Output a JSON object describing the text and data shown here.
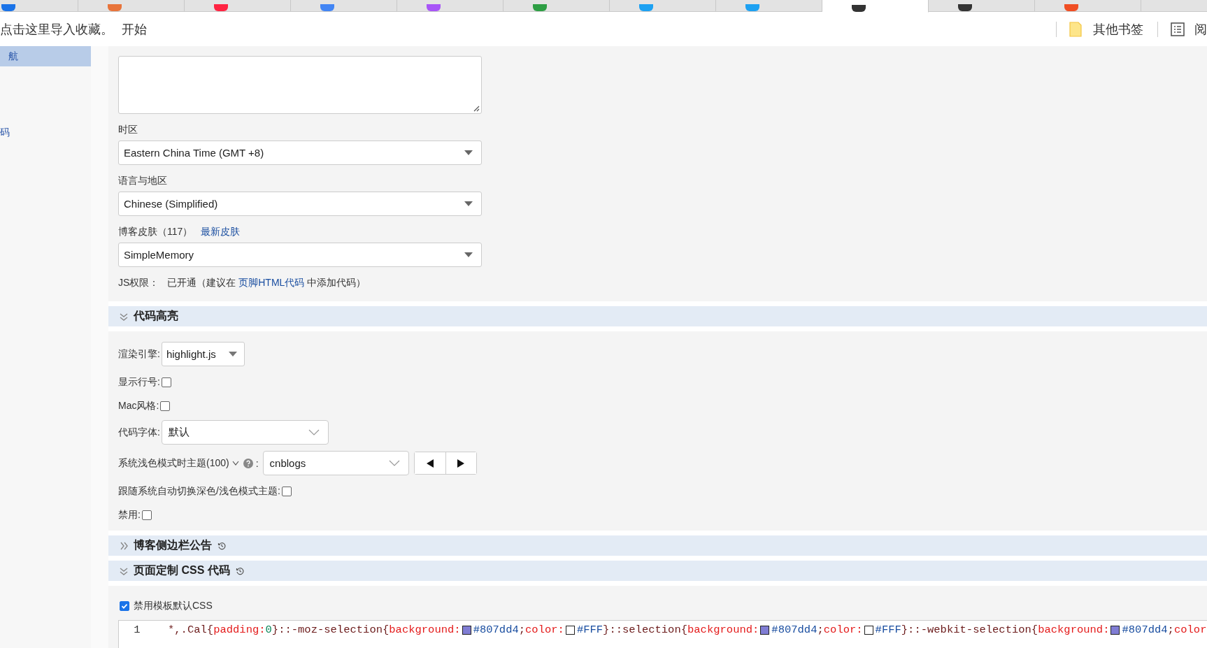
{
  "browser": {
    "tabs": [
      {
        "selected": false,
        "color": "#1a73e8"
      },
      {
        "selected": false,
        "color": "#e8743b"
      },
      {
        "selected": false,
        "color": "#ff2442"
      },
      {
        "selected": false,
        "color": "#4285f4"
      },
      {
        "selected": false,
        "color": "#a855f7"
      },
      {
        "selected": false,
        "color": "#2e9e44"
      },
      {
        "selected": false,
        "color": "#1da1f2"
      },
      {
        "selected": false,
        "color": "#1da1f2"
      },
      {
        "selected": true,
        "color": "#333333"
      },
      {
        "selected": false,
        "color": "#333333"
      },
      {
        "selected": false,
        "color": "#f04e23"
      }
    ],
    "bookmarks_bar": {
      "import_text": "点击这里导入收藏。",
      "start": "开始",
      "other_bookmarks": "其他书签",
      "reading_list": "阅"
    }
  },
  "sidebar": {
    "items": [
      {
        "label": "航",
        "selected": true
      },
      {
        "label": "码",
        "selected": false
      }
    ]
  },
  "basic_settings": {
    "fields": [
      {
        "label": "时区",
        "value": "Eastern China Time (GMT +8)"
      },
      {
        "label": "语言与地区",
        "value": "Chinese (Simplified)"
      },
      {
        "label": "博客皮肤（117）",
        "link": "最新皮肤",
        "value": "SimpleMemory"
      }
    ],
    "js_permission": {
      "label": "JS权限：",
      "before": "已开通（建议在 ",
      "link": "页脚HTML代码",
      "after": " 中添加代码）"
    }
  },
  "sections": [
    {
      "title": "代码高亮",
      "expanded": true,
      "rows": [
        {
          "kind": "dropdown",
          "label": "渲染引擎:",
          "value": "highlight.js"
        },
        {
          "kind": "checkbox",
          "label": "显示行号:",
          "checked": false
        },
        {
          "kind": "checkbox",
          "label": "Mac风格:",
          "checked": false
        },
        {
          "kind": "select",
          "label": "代码字体:",
          "value": "默认"
        },
        {
          "kind": "theme",
          "label": "系统浅色模式时主题(100)",
          "separator": ":",
          "value": "cnblogs"
        },
        {
          "kind": "checkbox",
          "label": "跟随系统自动切换深色/浅色模式主题:",
          "checked": false
        },
        {
          "kind": "checkbox",
          "label": "禁用:",
          "checked": false
        }
      ]
    },
    {
      "title": "博客侧边栏公告",
      "expanded": false,
      "history": true
    },
    {
      "title": "页面定制 CSS 代码",
      "expanded": true,
      "history": true,
      "rows": [
        {
          "kind": "check_label",
          "label": "禁用模板默认CSS",
          "checked": true
        },
        {
          "kind": "code",
          "lines": [
            {
              "number": "1",
              "tokens": [
                {
                  "kind": "sel",
                  "text": "*,.Cal{"
                },
                {
                  "kind": "prop",
                  "text": "padding:"
                },
                {
                  "kind": "num",
                  "text": "0"
                },
                {
                  "kind": "sel",
                  "text": "}::-moz-selection{"
                },
                {
                  "kind": "prop",
                  "text": "background:"
                },
                {
                  "kind": "swatch",
                  "color": "#807dd4"
                },
                {
                  "kind": "hex",
                  "text": "#807dd4"
                },
                {
                  "kind": "sel",
                  "text": ";"
                },
                {
                  "kind": "prop",
                  "text": "color:"
                },
                {
                  "kind": "swatch",
                  "color": "#ffffff"
                },
                {
                  "kind": "hex",
                  "text": "#FFF"
                },
                {
                  "kind": "sel",
                  "text": "}::selection{"
                },
                {
                  "kind": "prop",
                  "text": "background:"
                },
                {
                  "kind": "swatch",
                  "color": "#807dd4"
                },
                {
                  "kind": "hex",
                  "text": "#807dd4"
                },
                {
                  "kind": "sel",
                  "text": ";"
                },
                {
                  "kind": "prop",
                  "text": "color:"
                },
                {
                  "kind": "swatch",
                  "color": "#ffffff"
                },
                {
                  "kind": "hex",
                  "text": "#FFF"
                },
                {
                  "kind": "sel",
                  "text": "}::-webkit-selection{"
                },
                {
                  "kind": "prop",
                  "text": "background:"
                },
                {
                  "kind": "swatch",
                  "color": "#807dd4"
                },
                {
                  "kind": "hex",
                  "text": "#807dd4"
                },
                {
                  "kind": "sel",
                  "text": ";"
                },
                {
                  "kind": "prop",
                  "text": "color"
                }
              ]
            }
          ]
        }
      ]
    }
  ]
}
